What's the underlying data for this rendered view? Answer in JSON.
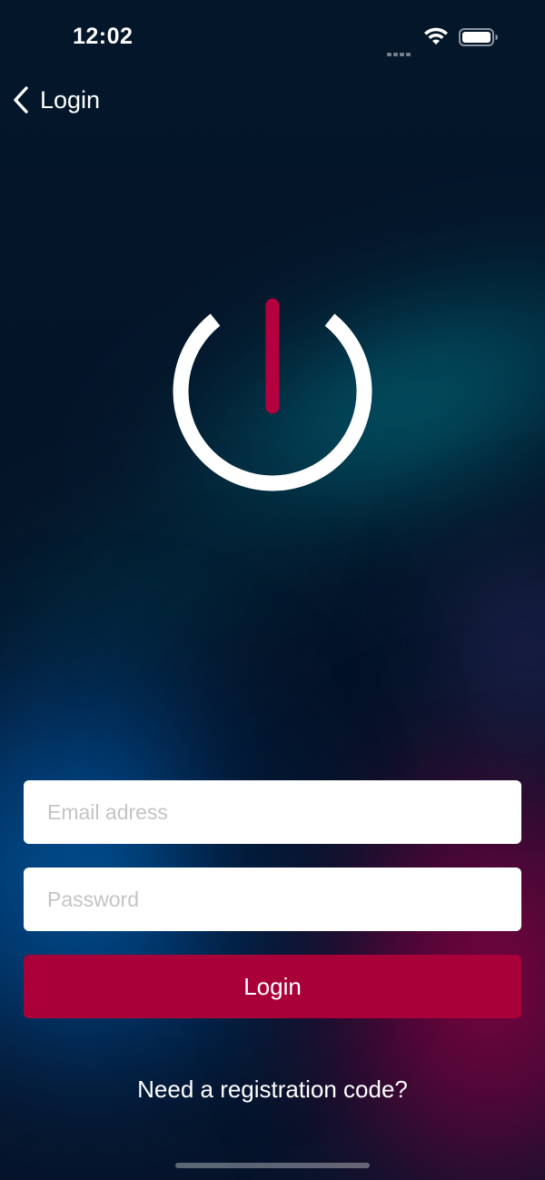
{
  "status_bar": {
    "time": "12:02",
    "signal_icon": "cellular-signal-icon",
    "wifi_icon": "wifi-icon",
    "battery_icon": "battery-full-icon"
  },
  "nav": {
    "back_icon": "chevron-left-icon",
    "back_label": "Login"
  },
  "logo": {
    "icon": "power-icon",
    "ring_color": "#ffffff",
    "stem_color": "#b4003f"
  },
  "form": {
    "email": {
      "value": "",
      "placeholder": "Email adress"
    },
    "password": {
      "value": "",
      "placeholder": "Password"
    },
    "login_button": "Login"
  },
  "footer": {
    "registration_link": "Need a registration code?"
  },
  "colors": {
    "accent": "#a9003a",
    "field_background": "#ffffff",
    "placeholder": "#c4c4c6",
    "background_dark": "#041428"
  }
}
